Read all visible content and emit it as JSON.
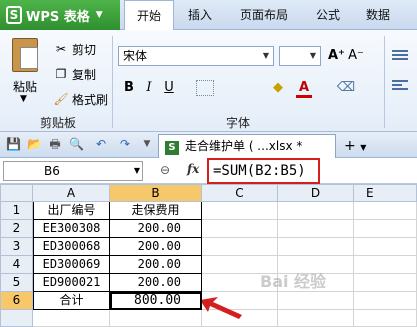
{
  "menubar": {
    "app_button": "WPS 表格",
    "app_logo": "S",
    "tabs": [
      "开始",
      "插入",
      "页面布局",
      "公式",
      "数据"
    ],
    "active_tab": 0
  },
  "ribbon": {
    "clipboard": {
      "paste_label": "粘贴",
      "cut_label": "剪切",
      "copy_label": "复制",
      "format_painter_label": "格式刷",
      "group_label": "剪贴板"
    },
    "font": {
      "font_name": "宋体",
      "bold": "B",
      "italic": "I",
      "underline": "U",
      "grow": "A⁺",
      "shrink": "A⁻",
      "font_color": "A",
      "group_label": "字体"
    }
  },
  "docbar": {
    "doc_tab_label": "走合维护单 ( ...xlsx *",
    "excel_icon_letter": "S",
    "new_tab_label": "+"
  },
  "formula_bar": {
    "name_box": "B6",
    "zoom_icon": "⊖",
    "fx_label": "fx",
    "formula": "=SUM(B2:B5)"
  },
  "sheet": {
    "columns": [
      "A",
      "B",
      "C",
      "D",
      "E"
    ],
    "rows": [
      {
        "num": "1",
        "a": "出厂编号",
        "b": "走保费用"
      },
      {
        "num": "2",
        "a": "EE300308",
        "b": "200.00"
      },
      {
        "num": "3",
        "a": "ED300068",
        "b": "200.00"
      },
      {
        "num": "4",
        "a": "ED300069",
        "b": "200.00"
      },
      {
        "num": "5",
        "a": "ED900021",
        "b": "200.00"
      },
      {
        "num": "6",
        "a": "合计",
        "b": "800.00"
      }
    ],
    "active_cell": "B6"
  },
  "colors": {
    "highlight_box": "#d41f1f",
    "selected_header": "#f6c86a",
    "wps_green": "#3a9d3a"
  },
  "watermark": "Bai 经验"
}
